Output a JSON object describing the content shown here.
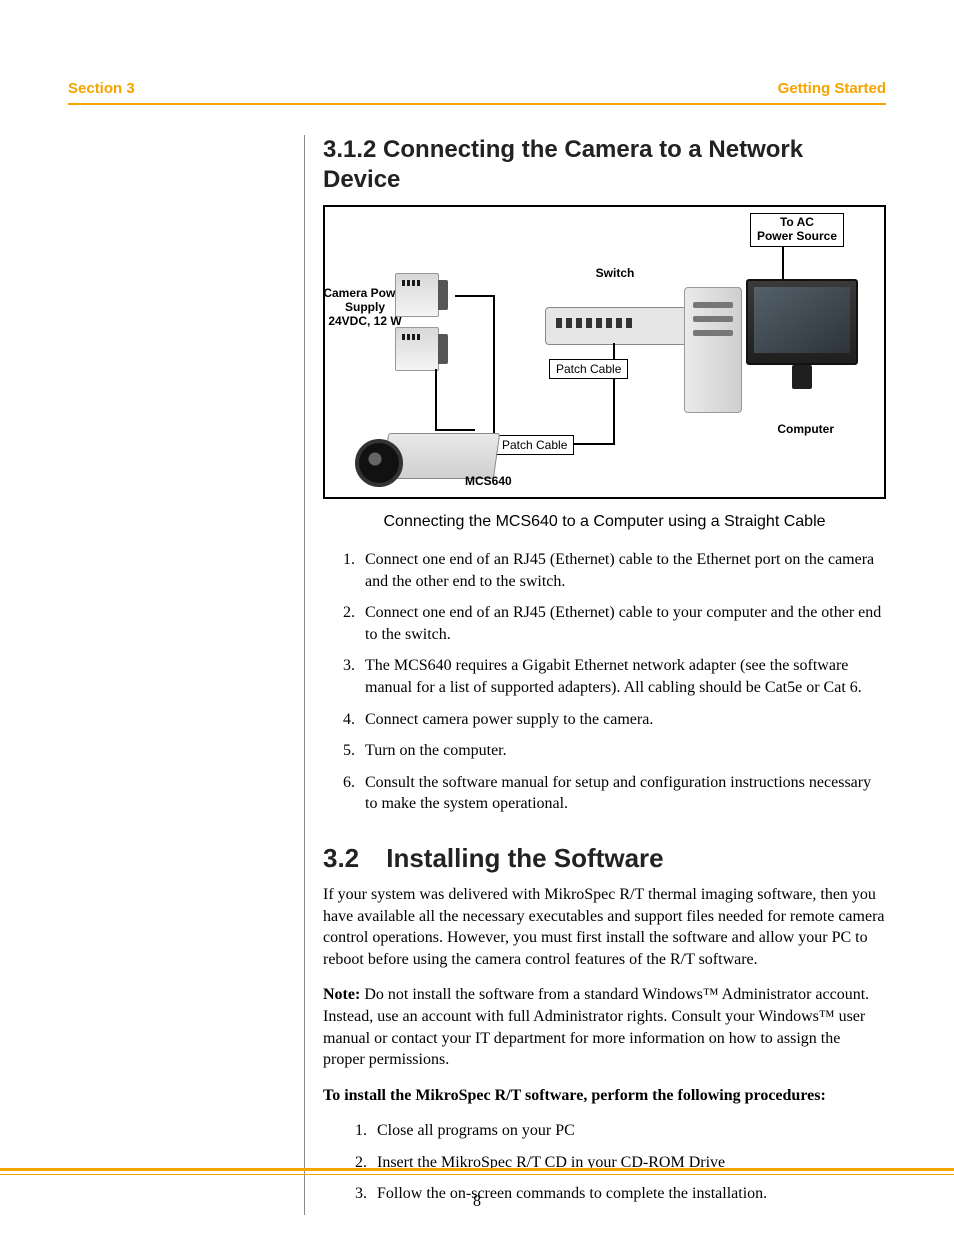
{
  "header": {
    "left": "Section 3",
    "right": "Getting Started"
  },
  "subsection_title": "3.1.2 Connecting the Camera to a Network Device",
  "diagram": {
    "to_ac": "To AC\nPower Source",
    "switch": "Switch",
    "power_supply": "Camera Power\nSupply\n24VDC, 12 W",
    "patch_cable": "Patch Cable",
    "computer": "Computer",
    "camera_model": "MCS640"
  },
  "figure_caption": "Connecting the MCS640 to a Computer using a Straight Cable",
  "steps_connect": [
    "Connect one end of an RJ45 (Ethernet) cable to the Ethernet port on the camera and the other end to the switch.",
    "Connect one end of an RJ45 (Ethernet) cable to your computer and the other end to the switch.",
    "The MCS640 requires a Gigabit Ethernet network adapter (see the software manual for a list of supported adapters). All cabling should be Cat5e or Cat 6.",
    "Connect camera power supply to the camera.",
    "Turn on the computer.",
    "Consult the software manual for setup and configuration instructions necessary to make the system operational."
  ],
  "section_title": {
    "num": "3.2",
    "text": "Installing the Software"
  },
  "install_intro": "If your system was delivered with MikroSpec R/T thermal imaging software, then you have available all the necessary executables and support files needed for remote camera control operations. However, you must first install the software and allow your PC to reboot before using the camera control features of the R/T software.",
  "note_label": "Note:",
  "note_text": " Do not install the software from a standard Windows™ Administrator account. Instead, use an account with full Administrator rights. Consult your Windows™ user manual or contact your IT department for more information on how to assign the proper permissions.",
  "install_heading": "To install the MikroSpec R/T software, perform the following procedures:",
  "steps_install": [
    "Close all programs on your PC",
    "Insert the MikroSpec R/T CD in your CD-ROM Drive",
    "Follow the on-screen commands to complete the installation."
  ],
  "page_number": "8"
}
